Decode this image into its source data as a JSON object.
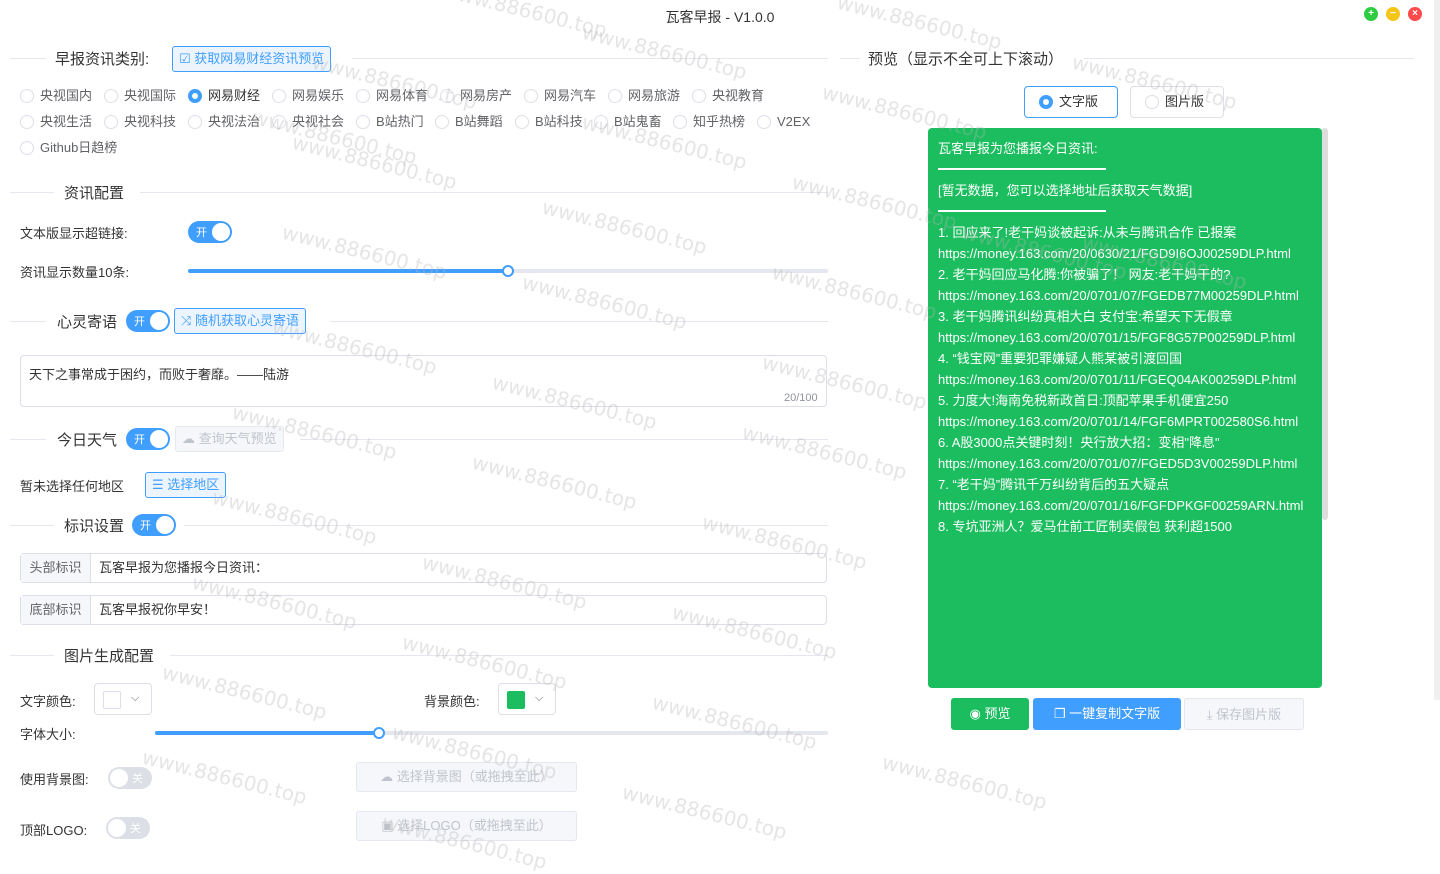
{
  "window": {
    "title": "瓦客早报 - V1.0.0"
  },
  "category": {
    "title": "早报资讯类别:",
    "fetch_button": "获取网易财经资讯预览",
    "options": [
      "央视国内",
      "央视国际",
      "网易财经",
      "网易娱乐",
      "网易体育",
      "网易房产",
      "网易汽车",
      "网易旅游",
      "央视教育",
      "央视生活",
      "央视科技",
      "央视法治",
      "央视社会",
      "B站热门",
      "B站舞蹈",
      "B站科技",
      "B站鬼畜",
      "知乎热榜",
      "V2EX",
      "Github日趋榜"
    ],
    "selected": "网易财经"
  },
  "news_config": {
    "title": "资讯配置",
    "hyperlink_label": "文本版显示超链接:",
    "hyperlink_switch": "开",
    "count_label": "资讯显示数量10条:",
    "count_value": 10
  },
  "soul": {
    "title": "心灵寄语",
    "switch": "开",
    "random_button": "随机获取心灵寄语",
    "text": "天下之事常成于困约，而败于奢靡。——陆游",
    "counter": "20/100"
  },
  "weather": {
    "title": "今日天气",
    "switch": "开",
    "preview_button": "查询天气预览",
    "no_region": "暂未选择任何地区",
    "select_region_button": "选择地区"
  },
  "marks": {
    "title": "标识设置",
    "switch": "开",
    "header_label": "头部标识",
    "header_value": "瓦客早报为您播报今日资讯：",
    "footer_label": "底部标识",
    "footer_value": "瓦客早报祝你早安！"
  },
  "image_config": {
    "title": "图片生成配置",
    "text_color_label": "文字颜色:",
    "text_color": "#ffffff",
    "bg_color_label": "背景颜色:",
    "bg_color": "#1bbd5f",
    "font_size_label": "字体大小:",
    "use_bg_label": "使用背景图:",
    "use_bg_switch": "关",
    "select_bg_button": "选择背景图（或拖拽至此）",
    "top_logo_label": "顶部LOGO:",
    "top_logo_switch": "关",
    "select_logo_button": "选择LOGO（或拖拽至此）"
  },
  "preview": {
    "title": "预览（显示不全可上下滚动）",
    "tab_text": "文字版",
    "tab_image": "图片版",
    "header": "瓦客早报为您播报今日资讯:",
    "weather_placeholder": "[暂无数据，您可以选择地址后获取天气数据]",
    "news": [
      "1. 回应来了!老干妈谈被起诉:从未与腾讯合作 已报案",
      "https://money.163.com/20/0630/21/FGD9I6OJ00259DLP.html",
      "2. 老干妈回应马化腾:你被骗了！ 网友:老干妈干的?",
      "https://money.163.com/20/0701/07/FGEDB77M00259DLP.html",
      "3. 老干妈腾讯纠纷真相大白 支付宝:希望天下无假章",
      "https://money.163.com/20/0701/15/FGF8G57P00259DLP.html",
      "4. “钱宝网”重要犯罪嫌疑人熊某被引渡回国",
      "https://money.163.com/20/0701/11/FGEQ04AK00259DLP.html",
      "5. 力度大!海南免税新政首日:顶配苹果手机便宜250",
      "https://money.163.com/20/0701/14/FGF6MPRT002580S6.html",
      "6. A股3000点关键时刻！央行放大招：变相\"降息\"",
      "https://money.163.com/20/0701/07/FGED5D3V00259DLP.html",
      "7. “老干妈”腾讯千万纠纷背后的五大疑点",
      "https://money.163.com/20/0701/16/FGFDPKGF00259ARN.html",
      "8. 专坑亚洲人？爱马仕前工匠制卖假包 获利超1500"
    ],
    "btn_preview": "预览",
    "btn_copy": "一键复制文字版",
    "btn_save": "保存图片版"
  },
  "watermark": "www.886600.top",
  "colors": {
    "primary": "#409eff",
    "green": "#1bbd5f",
    "win_green": "#2ecc40",
    "win_yellow": "#f5c518",
    "win_red": "#ff4b4b"
  }
}
